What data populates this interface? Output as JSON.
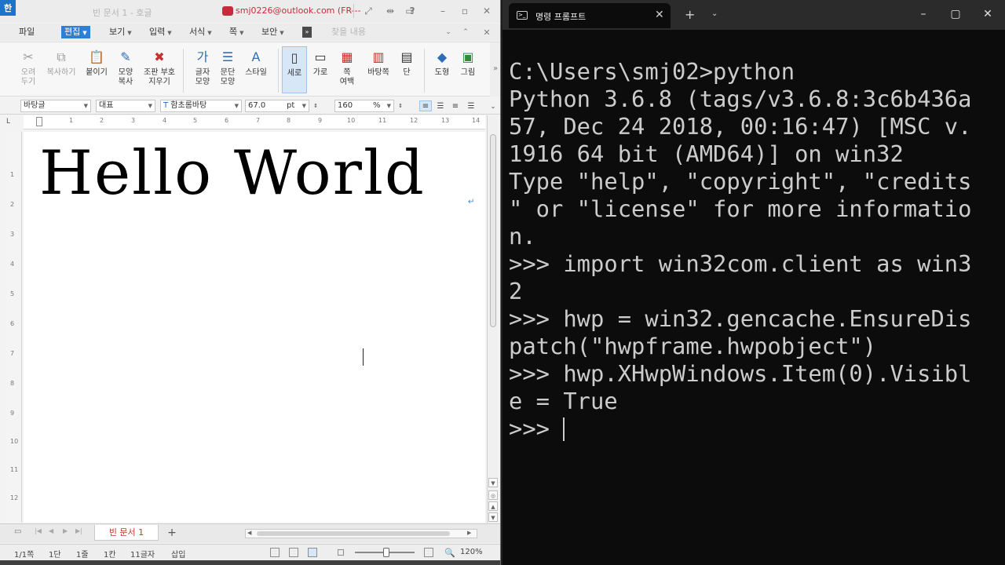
{
  "hwp": {
    "logo": "한",
    "doc_title": "빈 문서 1 - 호글",
    "account": "smj0226@outlook.com (FR---",
    "help_label": "?",
    "menus": [
      {
        "label": "파일"
      },
      {
        "label": "편집"
      },
      {
        "label": "보기"
      },
      {
        "label": "입력"
      },
      {
        "label": "서식"
      },
      {
        "label": "쪽"
      },
      {
        "label": "보안"
      }
    ],
    "search_placeholder": "찾을 내용",
    "ribbon": [
      {
        "label": "오려\n두기",
        "icon": "scissors-icon"
      },
      {
        "label": "복사하기",
        "icon": "copy-icon"
      },
      {
        "label": "붙이기",
        "icon": "paste-icon"
      },
      {
        "label": "모양\n복사",
        "icon": "format-painter-icon"
      },
      {
        "label": "조판 부호\n지우기",
        "icon": "clear-format-icon"
      },
      {
        "label": "글자\n모양",
        "icon": "char-shape-icon"
      },
      {
        "label": "문단\n모양",
        "icon": "para-shape-icon"
      },
      {
        "label": "스타일",
        "icon": "style-icon"
      },
      {
        "label": "세로",
        "icon": "portrait-icon"
      },
      {
        "label": "가로",
        "icon": "landscape-icon"
      },
      {
        "label": "쪽\n여백",
        "icon": "margin-icon"
      },
      {
        "label": "바탕쪽",
        "icon": "master-page-icon"
      },
      {
        "label": "단",
        "icon": "columns-icon"
      },
      {
        "label": "도형",
        "icon": "shape-icon"
      },
      {
        "label": "그림",
        "icon": "picture-icon"
      }
    ],
    "format": {
      "style": "바탕글",
      "lang": "대표",
      "font": "함초롬바탕",
      "size": "67.0",
      "size_unit": "pt",
      "spacing": "160",
      "spacing_unit": "%"
    },
    "ruler_ticks": [
      "1",
      "2",
      "3",
      "4",
      "5",
      "6",
      "7",
      "8",
      "9",
      "10",
      "11",
      "12",
      "13",
      "14"
    ],
    "vruler_ticks": [
      "1",
      "2",
      "3",
      "4",
      "5",
      "6",
      "7",
      "8",
      "9",
      "10",
      "11",
      "12"
    ],
    "document_text": "Hello World",
    "para_mark": "↵",
    "tab_label": "빈 문서 1",
    "tab_add": "+",
    "status": {
      "page": "1/1쪽",
      "section": "1단",
      "line": "1줄",
      "col": "1칸",
      "chars": "11글자",
      "mode": "삽입",
      "zoom": "120%"
    }
  },
  "cmd": {
    "tab_title": "명령 프롬프트",
    "lines": [
      "C:\\Users\\smj02>python",
      "Python 3.6.8 (tags/v3.6.8:3c6b436a",
      "57, Dec 24 2018, 00:16:47) [MSC v.",
      "1916 64 bit (AMD64)] on win32",
      "Type \"help\", \"copyright\", \"credits",
      "\" or \"license\" for more informatio",
      "n.",
      ">>> import win32com.client as win3",
      "2",
      ">>> hwp = win32.gencache.EnsureDis",
      "patch(\"hwpframe.hwpobject\")",
      ">>> hwp.XHwpWindows.Item(0).Visibl",
      "e = True",
      ">>> "
    ]
  }
}
